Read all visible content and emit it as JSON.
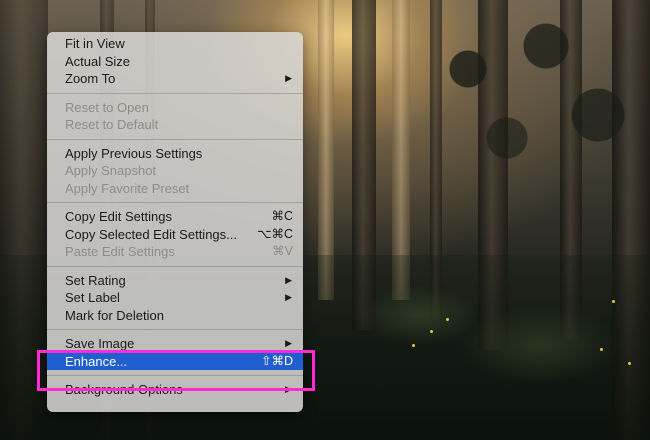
{
  "menu": {
    "groups": [
      [
        {
          "label": "Fit in View",
          "shortcut": "",
          "submenu": false,
          "disabled": false
        },
        {
          "label": "Actual Size",
          "shortcut": "",
          "submenu": false,
          "disabled": false
        },
        {
          "label": "Zoom To",
          "shortcut": "",
          "submenu": true,
          "disabled": false
        }
      ],
      [
        {
          "label": "Reset to Open",
          "shortcut": "",
          "submenu": false,
          "disabled": true
        },
        {
          "label": "Reset to Default",
          "shortcut": "",
          "submenu": false,
          "disabled": true
        }
      ],
      [
        {
          "label": "Apply Previous Settings",
          "shortcut": "",
          "submenu": false,
          "disabled": false
        },
        {
          "label": "Apply Snapshot",
          "shortcut": "",
          "submenu": false,
          "disabled": true
        },
        {
          "label": "Apply Favorite Preset",
          "shortcut": "",
          "submenu": false,
          "disabled": true
        }
      ],
      [
        {
          "label": "Copy Edit Settings",
          "shortcut": "⌘C",
          "submenu": false,
          "disabled": false
        },
        {
          "label": "Copy Selected Edit Settings...",
          "shortcut": "⌥⌘C",
          "submenu": false,
          "disabled": false
        },
        {
          "label": "Paste Edit Settings",
          "shortcut": "⌘V",
          "submenu": false,
          "disabled": true
        }
      ],
      [
        {
          "label": "Set Rating",
          "shortcut": "",
          "submenu": true,
          "disabled": false
        },
        {
          "label": "Set Label",
          "shortcut": "",
          "submenu": true,
          "disabled": false
        },
        {
          "label": "Mark for Deletion",
          "shortcut": "",
          "submenu": false,
          "disabled": false
        }
      ],
      [
        {
          "label": "Save Image",
          "shortcut": "",
          "submenu": true,
          "disabled": false
        },
        {
          "label": "Enhance...",
          "shortcut": "⇧⌘D",
          "submenu": false,
          "disabled": false,
          "highlighted": true
        }
      ],
      [
        {
          "label": "Background Options",
          "shortcut": "",
          "submenu": true,
          "disabled": false
        }
      ]
    ],
    "submenu_glyph": "▶"
  },
  "colors": {
    "highlight": "#1f5fcf",
    "annotation": "#ff2ad4"
  }
}
